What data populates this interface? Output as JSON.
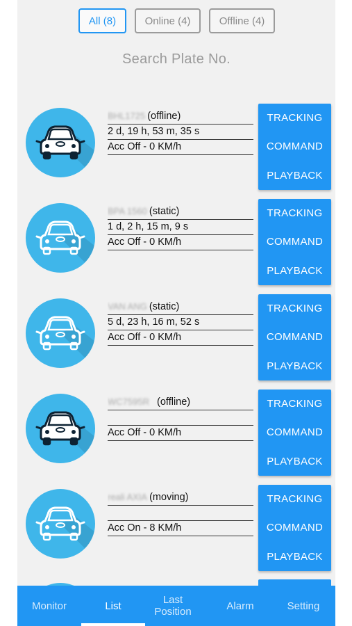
{
  "filters": [
    {
      "label": "All (8)",
      "active": true
    },
    {
      "label": "Online (4)",
      "active": false
    },
    {
      "label": "Offline (4)",
      "active": false
    }
  ],
  "search": {
    "placeholder": "Search Plate No."
  },
  "vehicles": [
    {
      "plate": "BHL1725",
      "status": "(offline)",
      "duration": "2 d, 19 h, 53 m, 35 s",
      "acc": "Acc Off - 0 KM/h",
      "icon": "car-dark-icon"
    },
    {
      "plate": "BPA 1560",
      "status": "(static)",
      "duration": "1 d, 2 h, 15 m, 9 s",
      "acc": "Acc Off - 0 KM/h",
      "icon": "car-white-icon"
    },
    {
      "plate": "VAN ANG",
      "status": "(static)",
      "duration": "5 d, 23 h, 16 m, 52 s",
      "acc": "Acc Off - 0 KM/h",
      "icon": "car-white-icon"
    },
    {
      "plate": "WC7595R",
      "status": "(offline)",
      "duration": "",
      "acc": "Acc Off - 0 KM/h",
      "icon": "car-dark-icon"
    },
    {
      "plate": "reali AXIA",
      "status": "(moving)",
      "duration": "",
      "acc": "Acc On - 8 KM/h",
      "icon": "car-white-icon"
    }
  ],
  "actions": {
    "tracking": "TRACKING",
    "command": "COMMAND",
    "playback": "PLAYBACK"
  },
  "tabs": [
    {
      "label": "Monitor",
      "active": false
    },
    {
      "label": "List",
      "active": true
    },
    {
      "label": "Last Position",
      "active": false
    },
    {
      "label": "Alarm",
      "active": false
    },
    {
      "label": "Setting",
      "active": false
    }
  ],
  "colors": {
    "primary": "#2196F3",
    "avatar": "#3fb6ea",
    "background": "#f1f1f1"
  }
}
